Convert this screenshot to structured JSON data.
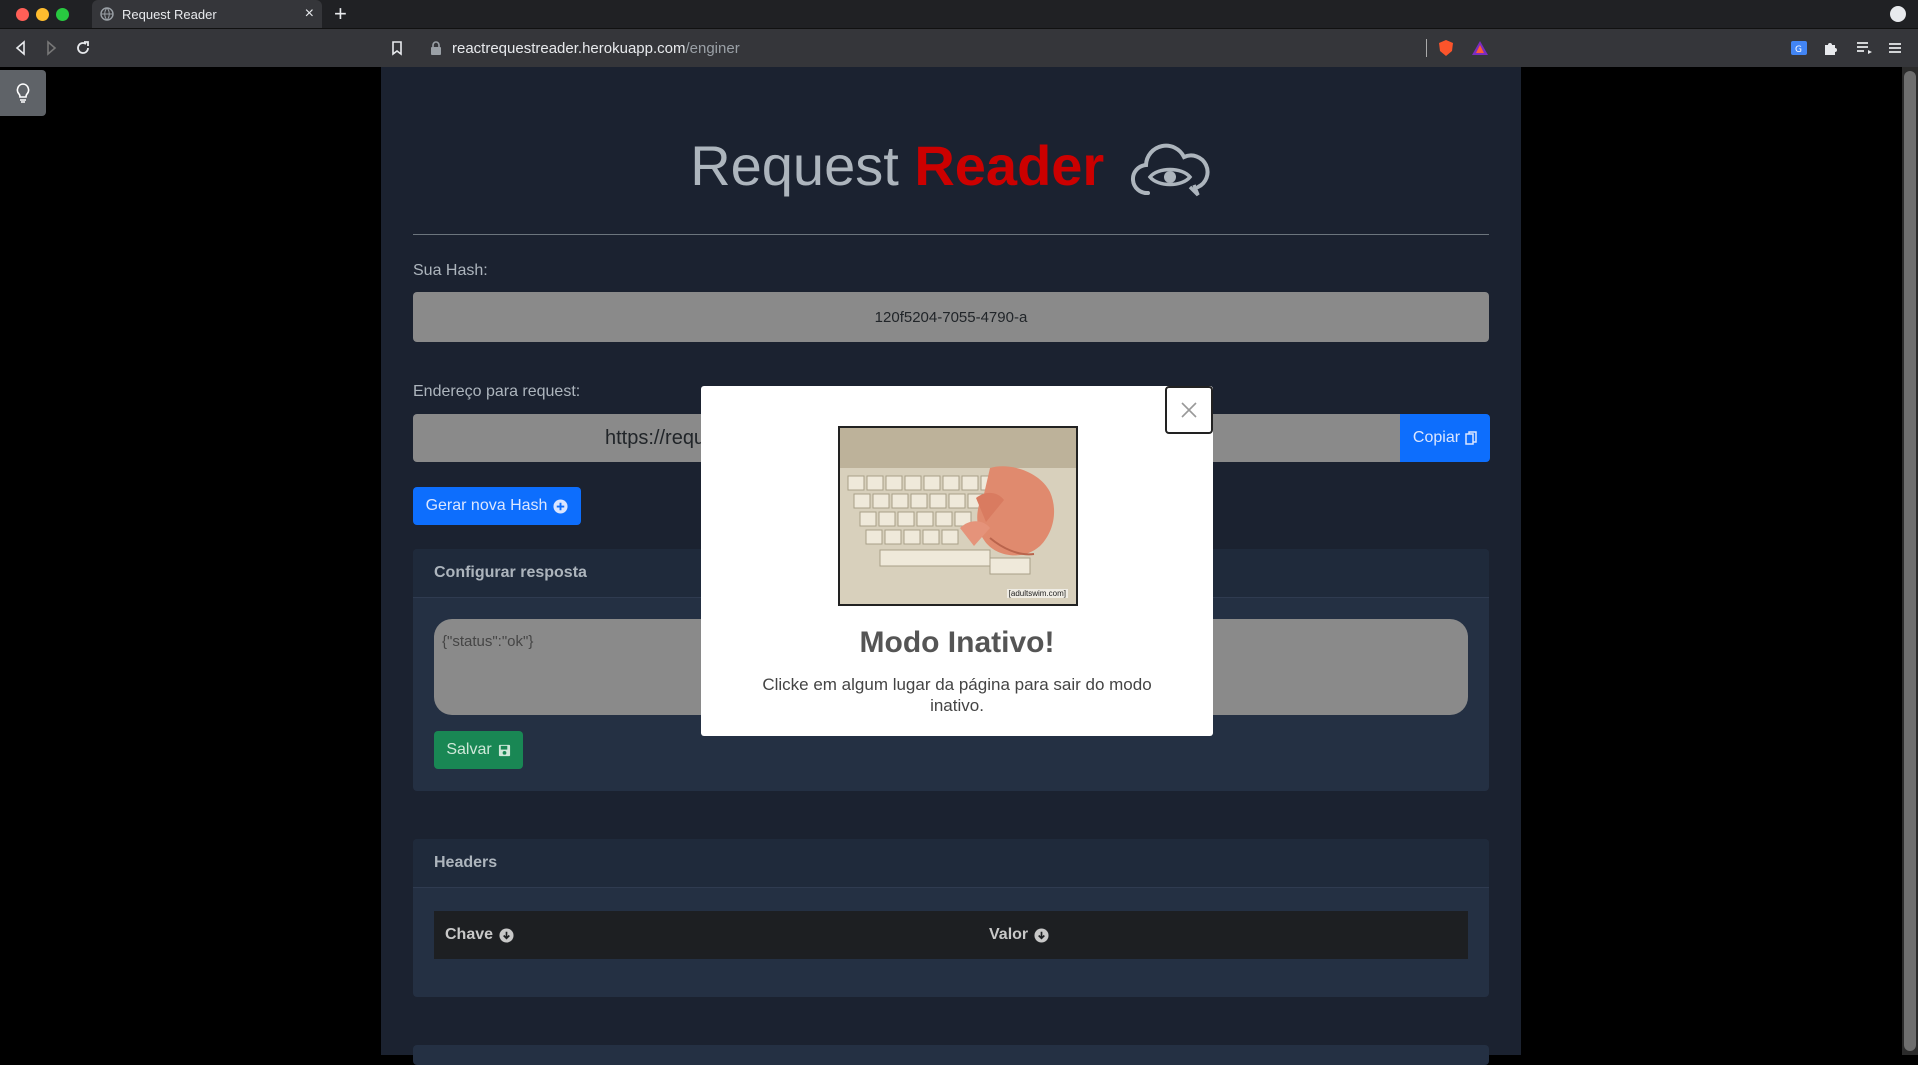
{
  "browser": {
    "tab_title": "Request Reader",
    "tab_close": "×",
    "new_tab": "+",
    "url_host": "reactrequestreader.herokuapp.com",
    "url_path": "/enginer"
  },
  "app": {
    "title_part1": "Request",
    "title_part2": "Reader",
    "accent_color": "#cc0000",
    "hash_label": "Sua Hash:",
    "hash_value": "120f5204-7055-4790-a",
    "address_label": "Endereço para request:",
    "address_value": "https://requ",
    "copy_label": "Copiar",
    "generate_label": "Gerar nova Hash",
    "response_card_title": "Configurar resposta",
    "response_value": "{\"status\":\"ok\"}",
    "save_label": "Salvar",
    "headers_card_title": "Headers",
    "headers_columns": [
      "Chave",
      "Valor"
    ]
  },
  "modal": {
    "title": "Modo Inativo!",
    "text": "Clicke em algum lugar da página para sair do modo inativo.",
    "gif_credit": "[adultswim.com]"
  }
}
